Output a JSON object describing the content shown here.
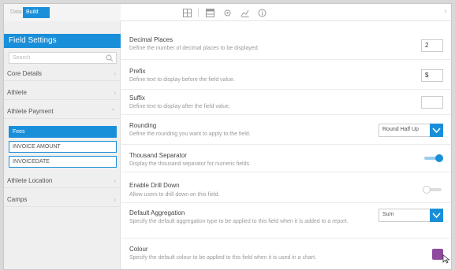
{
  "mode_tabs": [
    "Data",
    "Build"
  ],
  "toolbar": {
    "icons": [
      "grid-icon",
      "table-icon",
      "settings-icon",
      "chart-icon",
      "info-icon"
    ]
  },
  "sidebar": {
    "title": "Field Settings",
    "search_placeholder": "Search",
    "groups": [
      {
        "label": "Core Details"
      },
      {
        "label": "Athlete"
      },
      {
        "label": "Athlete Payment"
      }
    ],
    "fields": [
      {
        "label": "Fees",
        "active": true
      },
      {
        "label": "INVOICE AMOUNT",
        "active": false
      },
      {
        "label": "INVOICEDATE",
        "active": false
      }
    ],
    "groups_after": [
      {
        "label": "Athlete Location"
      },
      {
        "label": "Camps"
      }
    ]
  },
  "settings": {
    "decimal_places": {
      "label": "Decimal Places",
      "desc": "Define the number of decimal places to be displayed.",
      "value": "2"
    },
    "prefix": {
      "label": "Prefix",
      "desc": "Define text to display before the field value.",
      "value": "$"
    },
    "suffix": {
      "label": "Suffix",
      "desc": "Define text to display after the field value.",
      "value": ""
    },
    "rounding": {
      "label": "Rounding",
      "desc": "Define the rounding you want to apply to the field.",
      "value": "Round Half Up"
    },
    "thousand_separator": {
      "label": "Thousand Separator",
      "desc": "Display the thousand separator for numeric fields.",
      "on": true
    },
    "enable_drill_down": {
      "label": "Enable Drill Down",
      "desc": "Allow users to drill down on this field.",
      "on": false
    },
    "default_aggregation": {
      "label": "Default Aggregation",
      "desc": "Specify the default aggregation type to be applied to this field when it is added to a report.",
      "value": "Sum"
    },
    "colour": {
      "label": "Colour",
      "desc": "Specify the default colour to be applied to this field when it is used in a chart.",
      "value": "#8e4a9e"
    }
  },
  "colors": {
    "accent": "#1a8fd9",
    "sidebar_bg": "#efefef",
    "swatch": "#8e4a9e"
  }
}
